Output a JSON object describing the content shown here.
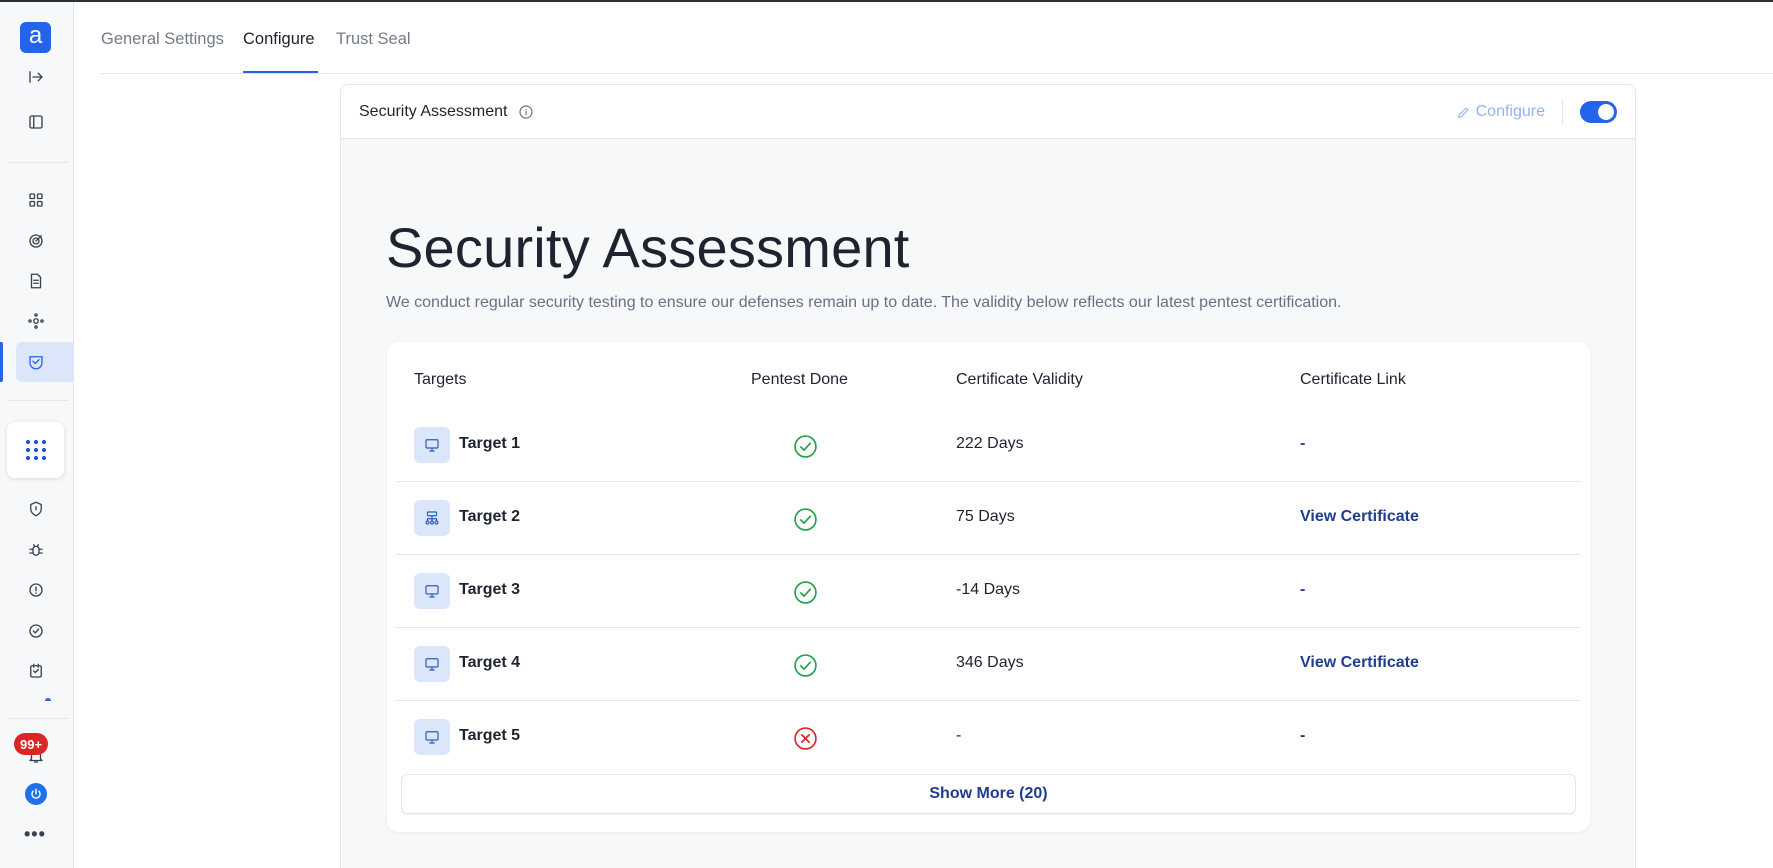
{
  "app": {
    "logo_letter": "a"
  },
  "sidebar": {
    "badge": "99+",
    "items": [
      {
        "icon": "collapse-arrow-icon"
      },
      {
        "icon": "panel-icon"
      },
      {
        "icon": "dashboard-grid-icon"
      },
      {
        "icon": "target-icon"
      },
      {
        "icon": "document-icon"
      },
      {
        "icon": "integration-icon"
      },
      {
        "icon": "handshake-icon",
        "active": true
      },
      {
        "icon": "apps-grid-icon"
      },
      {
        "icon": "shield-icon"
      },
      {
        "icon": "bug-icon"
      },
      {
        "icon": "alert-circle-icon"
      },
      {
        "icon": "check-circle-icon"
      },
      {
        "icon": "calendar-icon"
      },
      {
        "icon": "bell-icon"
      },
      {
        "icon": "power-icon"
      },
      {
        "icon": "more-icon"
      }
    ]
  },
  "tabs": [
    {
      "label": "General Settings",
      "active": false
    },
    {
      "label": "Configure",
      "active": true
    },
    {
      "label": "Trust Seal",
      "active": false
    }
  ],
  "card": {
    "title": "Security Assessment",
    "configure_label": "Configure",
    "toggle_on": true
  },
  "hero": {
    "title": "Security Assessment",
    "subtitle": "We conduct regular security testing to ensure our defenses remain up to date. The validity below reflects our latest pentest certification."
  },
  "table": {
    "headers": {
      "targets": "Targets",
      "pentest_done": "Pentest Done",
      "validity": "Certificate Validity",
      "link": "Certificate Link"
    },
    "rows": [
      {
        "name": "Target 1",
        "icon": "monitor-icon",
        "pentest_done": true,
        "validity": "222 Days",
        "link": "-"
      },
      {
        "name": "Target 2",
        "icon": "network-icon",
        "pentest_done": true,
        "validity": "75 Days",
        "link": "View Certificate"
      },
      {
        "name": "Target 3",
        "icon": "monitor-icon",
        "pentest_done": true,
        "validity": "-14 Days",
        "link": "-"
      },
      {
        "name": "Target 4",
        "icon": "monitor-icon",
        "pentest_done": true,
        "validity": "346 Days",
        "link": "View Certificate"
      },
      {
        "name": "Target 5",
        "icon": "monitor-icon",
        "pentest_done": false,
        "validity": "-",
        "link": "-"
      }
    ],
    "show_more": "Show More (20)"
  },
  "colors": {
    "accent": "#2563eb",
    "link": "#1f3d8f",
    "success": "#22a34a",
    "danger": "#dc2626"
  }
}
